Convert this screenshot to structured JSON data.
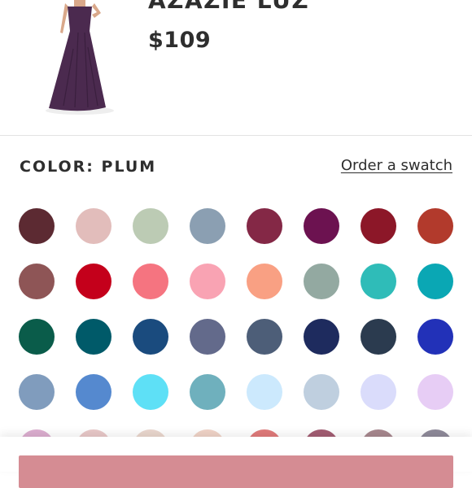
{
  "product": {
    "name": "AZAZIE LUZ",
    "price": "$109",
    "image_icon": "dress-photo",
    "dress_color": "#4b2a4f"
  },
  "color_section": {
    "label": "COLOR: PLUM",
    "swatch_link": "Order a swatch"
  },
  "swatches": [
    {
      "name": "color-1",
      "hex": "#5c2a32"
    },
    {
      "name": "color-2",
      "hex": "#e2bdbb"
    },
    {
      "name": "color-3",
      "hex": "#bccbb4"
    },
    {
      "name": "color-4",
      "hex": "#8b9fb2"
    },
    {
      "name": "color-5",
      "hex": "#842846"
    },
    {
      "name": "color-6",
      "hex": "#6c1250"
    },
    {
      "name": "color-7",
      "hex": "#8c1728"
    },
    {
      "name": "color-8",
      "hex": "#b23a2c"
    },
    {
      "name": "color-9",
      "hex": "#8e5556"
    },
    {
      "name": "color-10",
      "hex": "#c4001b"
    },
    {
      "name": "color-11",
      "hex": "#f57480"
    },
    {
      "name": "color-12",
      "hex": "#f9a3b3"
    },
    {
      "name": "color-13",
      "hex": "#f9a083"
    },
    {
      "name": "color-14",
      "hex": "#93a9a1"
    },
    {
      "name": "color-15",
      "hex": "#2fbcb8"
    },
    {
      "name": "color-16",
      "hex": "#0aa7b4"
    },
    {
      "name": "color-17",
      "hex": "#0a5c4a"
    },
    {
      "name": "color-18",
      "hex": "#005a69"
    },
    {
      "name": "color-19",
      "hex": "#1a4b7e"
    },
    {
      "name": "color-20",
      "hex": "#636a8b"
    },
    {
      "name": "color-21",
      "hex": "#4d5e78"
    },
    {
      "name": "color-22",
      "hex": "#1e2b5e"
    },
    {
      "name": "color-23",
      "hex": "#2b3b4f"
    },
    {
      "name": "color-24",
      "hex": "#2231b8"
    },
    {
      "name": "color-25",
      "hex": "#809cbd"
    },
    {
      "name": "color-26",
      "hex": "#5589cf"
    },
    {
      "name": "color-27",
      "hex": "#5ee0f6"
    },
    {
      "name": "color-28",
      "hex": "#6fb0bd"
    },
    {
      "name": "color-29",
      "hex": "#cce9fd"
    },
    {
      "name": "color-30",
      "hex": "#bfcfdf"
    },
    {
      "name": "color-31",
      "hex": "#dadcfb"
    },
    {
      "name": "color-32",
      "hex": "#e7cdf5"
    },
    {
      "name": "color-33",
      "hex": "#dcaed0"
    },
    {
      "name": "color-34",
      "hex": "#e8c8c8"
    },
    {
      "name": "color-35",
      "hex": "#ead7ce"
    },
    {
      "name": "color-36",
      "hex": "#f0d3c7"
    },
    {
      "name": "color-37",
      "hex": "#e07a7a"
    },
    {
      "name": "color-38",
      "hex": "#a35d73"
    },
    {
      "name": "color-39",
      "hex": "#a8888f"
    },
    {
      "name": "color-40",
      "hex": "#8f8a9a"
    }
  ],
  "bottom_bar": {
    "button_color": "#d58c93"
  }
}
